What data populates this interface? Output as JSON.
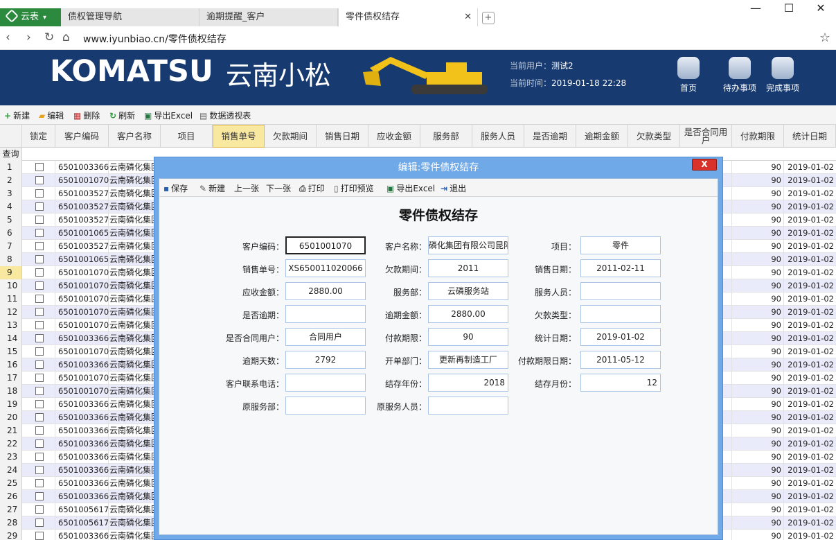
{
  "browser": {
    "app_tab": "云表",
    "tabs": [
      "债权管理导航",
      "逾期提醒_客户",
      "零件债权结存"
    ],
    "url": "www.iyunbiao.cn/零件债权结存"
  },
  "header": {
    "logo_text": "KOMATSU",
    "brand_cn": "云南小松",
    "current_user_label": "当前用户：",
    "current_user": "测试2",
    "current_time_label": "当前时间：",
    "current_time": "2019-01-18 22:28",
    "buttons": [
      "首页",
      "待办事项",
      "完成事项"
    ]
  },
  "toolbar": [
    "新建",
    "编辑",
    "删除",
    "刷新",
    "导出Excel",
    "数据透视表"
  ],
  "grid": {
    "columns": [
      "锁定",
      "客户编码",
      "客户名称",
      "项目",
      "销售单号",
      "欠款期间",
      "销售日期",
      "应收金额",
      "服务部",
      "服务人员",
      "是否逾期",
      "逾期金额",
      "欠款类型",
      "是否合同用户",
      "付款期限",
      "统计日期"
    ],
    "query_label": "查询",
    "rows": [
      {
        "n": "1",
        "code": "6501003366",
        "name": "云南磷化集团",
        "term": "90",
        "date": "2019-01-02"
      },
      {
        "n": "2",
        "code": "6501001070",
        "name": "云南磷化集团",
        "term": "90",
        "date": "2019-01-02"
      },
      {
        "n": "3",
        "code": "6501003527",
        "name": "云南磷化集团",
        "term": "90",
        "date": "2019-01-02"
      },
      {
        "n": "4",
        "code": "6501003527",
        "name": "云南磷化集团",
        "term": "90",
        "date": "2019-01-02"
      },
      {
        "n": "5",
        "code": "6501003527",
        "name": "云南磷化集团",
        "term": "90",
        "date": "2019-01-02"
      },
      {
        "n": "6",
        "code": "6501001065",
        "name": "云南磷化集团",
        "term": "90",
        "date": "2019-01-02"
      },
      {
        "n": "7",
        "code": "6501003527",
        "name": "云南磷化集团",
        "term": "90",
        "date": "2019-01-02"
      },
      {
        "n": "8",
        "code": "6501001065",
        "name": "云南磷化集团",
        "term": "90",
        "date": "2019-01-02"
      },
      {
        "n": "9",
        "code": "6501001070",
        "name": "云南磷化集团",
        "term": "90",
        "date": "2019-01-02"
      },
      {
        "n": "10",
        "code": "6501001070",
        "name": "云南磷化集团",
        "term": "90",
        "date": "2019-01-02"
      },
      {
        "n": "11",
        "code": "6501001070",
        "name": "云南磷化集团",
        "term": "90",
        "date": "2019-01-02"
      },
      {
        "n": "12",
        "code": "6501001070",
        "name": "云南磷化集团",
        "term": "90",
        "date": "2019-01-02"
      },
      {
        "n": "13",
        "code": "6501001070",
        "name": "云南磷化集团",
        "term": "90",
        "date": "2019-01-02"
      },
      {
        "n": "14",
        "code": "6501003366",
        "name": "云南磷化集团",
        "term": "90",
        "date": "2019-01-02"
      },
      {
        "n": "15",
        "code": "6501001070",
        "name": "云南磷化集团",
        "term": "90",
        "date": "2019-01-02"
      },
      {
        "n": "16",
        "code": "6501003366",
        "name": "云南磷化集团",
        "term": "90",
        "date": "2019-01-02"
      },
      {
        "n": "17",
        "code": "6501001070",
        "name": "云南磷化集团",
        "term": "90",
        "date": "2019-01-02"
      },
      {
        "n": "18",
        "code": "6501001070",
        "name": "云南磷化集团",
        "term": "90",
        "date": "2019-01-02"
      },
      {
        "n": "19",
        "code": "6501003366",
        "name": "云南磷化集团",
        "term": "90",
        "date": "2019-01-02"
      },
      {
        "n": "20",
        "code": "6501003366",
        "name": "云南磷化集团",
        "term": "90",
        "date": "2019-01-02"
      },
      {
        "n": "21",
        "code": "6501003366",
        "name": "云南磷化集团",
        "term": "90",
        "date": "2019-01-02"
      },
      {
        "n": "22",
        "code": "6501003366",
        "name": "云南磷化集团",
        "term": "90",
        "date": "2019-01-02"
      },
      {
        "n": "23",
        "code": "6501003366",
        "name": "云南磷化集团",
        "term": "90",
        "date": "2019-01-02"
      },
      {
        "n": "24",
        "code": "6501003366",
        "name": "云南磷化集团",
        "term": "90",
        "date": "2019-01-02"
      },
      {
        "n": "25",
        "code": "6501003366",
        "name": "云南磷化集团",
        "term": "90",
        "date": "2019-01-02"
      },
      {
        "n": "26",
        "code": "6501003366",
        "name": "云南磷化集团",
        "term": "90",
        "date": "2019-01-02"
      },
      {
        "n": "27",
        "code": "6501005617",
        "name": "云南磷化集团",
        "term": "90",
        "date": "2019-01-02"
      },
      {
        "n": "28",
        "code": "6501005617",
        "name": "云南磷化集团",
        "term": "90",
        "date": "2019-01-02"
      },
      {
        "n": "29",
        "code": "6501003366",
        "name": "云南磷化集团",
        "term": "90",
        "date": "2019-01-02"
      }
    ]
  },
  "dialog": {
    "title": "编辑:零件债权结存",
    "close": "X",
    "toolbar": [
      "保存",
      "新建",
      "上一张",
      "下一张",
      "打印",
      "打印预览",
      "导出Excel",
      "退出"
    ],
    "form_title": "零件债权结存",
    "fields": [
      {
        "label": "客户编码：",
        "value": "6501001070"
      },
      {
        "label": "客户名称：",
        "value": "磷化集团有限公司昆阳"
      },
      {
        "label": "项目：",
        "value": "零件"
      },
      {
        "label": "销售单号：",
        "value": "XS650011020066"
      },
      {
        "label": "欠款期间：",
        "value": "2011"
      },
      {
        "label": "销售日期：",
        "value": "2011-02-11"
      },
      {
        "label": "应收金额：",
        "value": "2880.00"
      },
      {
        "label": "服务部：",
        "value": "云磷服务站"
      },
      {
        "label": "服务人员：",
        "value": ""
      },
      {
        "label": "是否逾期：",
        "value": ""
      },
      {
        "label": "逾期金额：",
        "value": "2880.00"
      },
      {
        "label": "欠款类型：",
        "value": ""
      },
      {
        "label": "是否合同用户：",
        "value": "合同用户"
      },
      {
        "label": "付款期限：",
        "value": "90"
      },
      {
        "label": "统计日期：",
        "value": "2019-01-02"
      },
      {
        "label": "逾期天数：",
        "value": "2792"
      },
      {
        "label": "开单部门：",
        "value": "更新再制造工厂"
      },
      {
        "label": "付款期限日期：",
        "value": "2011-05-12"
      },
      {
        "label": "客户联系电话：",
        "value": ""
      },
      {
        "label": "结存年份：",
        "value": "2018"
      },
      {
        "label": "结存月份：",
        "value": "12"
      },
      {
        "label": "原服务部：",
        "value": ""
      },
      {
        "label": "原服务人员：",
        "value": ""
      }
    ]
  }
}
